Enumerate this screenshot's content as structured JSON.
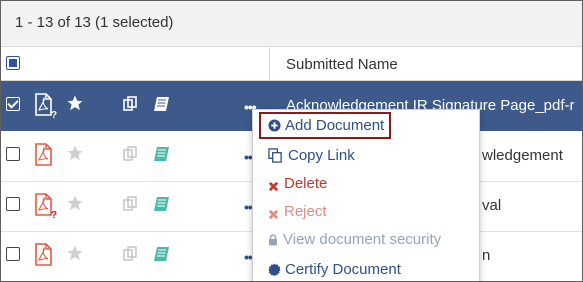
{
  "results": {
    "count_text": "1 - 13 of 13 (1 selected)"
  },
  "table": {
    "column_header": "Submitted Name",
    "rows": [
      {
        "name": "Acknowledgement IR Signature Page_pdf-r",
        "selected": true
      },
      {
        "name": "wledgement",
        "selected": false
      },
      {
        "name": "val",
        "selected": false
      },
      {
        "name": "n",
        "selected": false
      }
    ]
  },
  "menu": {
    "add_document": "Add Document",
    "copy_link": "Copy Link",
    "delete": "Delete",
    "reject": "Reject",
    "view_security": "View document security",
    "certify": "Certify Document"
  },
  "colors": {
    "selected_row": "#3d5a8a",
    "link_blue": "#2f4f8a",
    "delete_red": "#c0392b",
    "highlight_border": "#8b1a1a",
    "pdf_icon": "#e05a47",
    "teal_book": "#4cb8a8"
  },
  "icons": [
    "checkbox-icon",
    "pdf-icon",
    "question-icon",
    "star-icon",
    "copy-icon",
    "book-icon",
    "more-dots-icon",
    "plus-circle-icon",
    "copy-link-icon",
    "x-icon",
    "lock-icon",
    "certificate-icon"
  ]
}
